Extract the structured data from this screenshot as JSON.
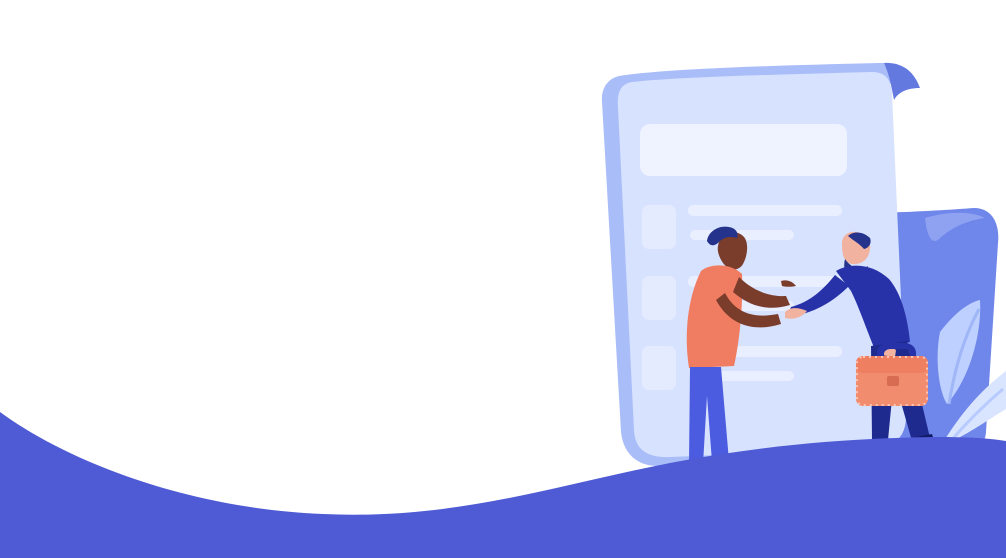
{
  "colors": {
    "background": "#ffffff",
    "wave": "#4f5bd5",
    "document_back": "#6f86ea",
    "document_front": "#cfdcff",
    "document_row": "#e8eeff",
    "person_left_shirt": "#f07d62",
    "person_left_pants": "#4b5ce0",
    "person_right_shirt": "#2732a8",
    "person_right_pants": "#1f2a8f",
    "briefcase": "#f28c6f",
    "leaf": "#dce7ff"
  },
  "illustration": {
    "subject": "handshake-agreement",
    "icons": [
      "document-icon",
      "briefcase-icon",
      "leaf-icon"
    ]
  }
}
